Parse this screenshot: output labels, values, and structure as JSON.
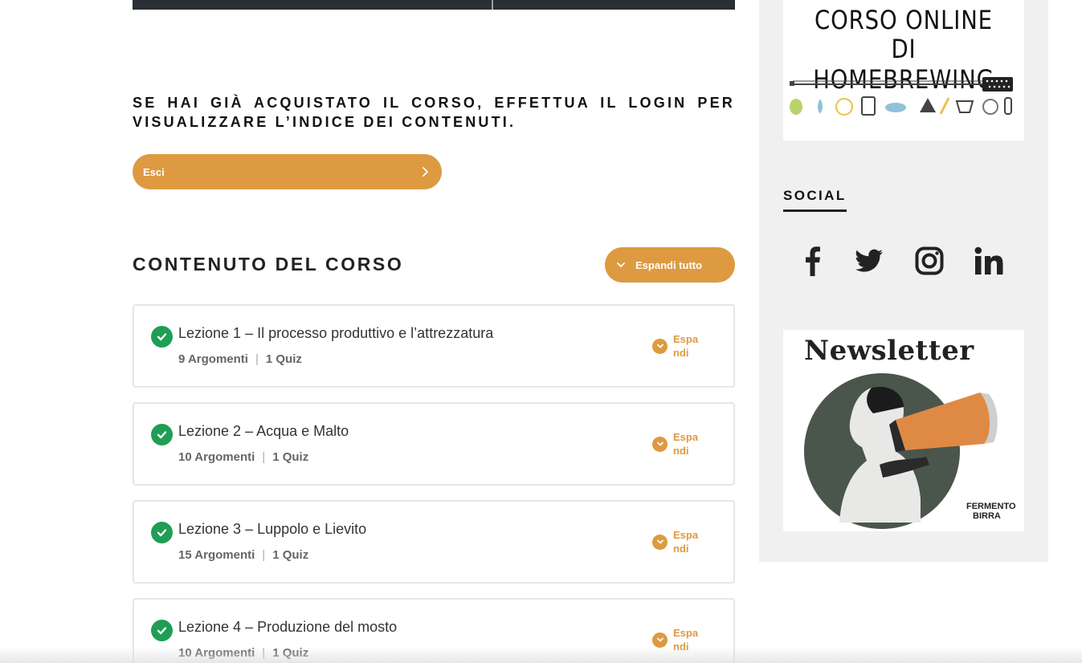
{
  "login_notice": "SE HAI GIÀ ACQUISTATO IL CORSO, EFFETTUA IL LOGIN PER VISUALIZZARE L’INDICE DEI CONTENUTI.",
  "exit_button": "Esci",
  "course_content": {
    "title": "CONTENUTO DEL CORSO",
    "expand_all": "Espandi tutto",
    "expand_label": "Espandi",
    "lessons": [
      {
        "title": "Lezione 1 – Il processo produttivo e l’attrezzatura",
        "topics": "9 Argomenti",
        "quiz": "1 Quiz",
        "completed": true
      },
      {
        "title": "Lezione 2 – Acqua e Malto",
        "topics": "10 Argomenti",
        "quiz": "1 Quiz",
        "completed": true
      },
      {
        "title": "Lezione 3 – Luppolo e Lievito",
        "topics": "15 Argomenti",
        "quiz": "1 Quiz",
        "completed": true
      },
      {
        "title": "Lezione 4 – Produzione del mosto",
        "topics": "10 Argomenti",
        "quiz": "1 Quiz",
        "completed": true
      }
    ]
  },
  "sidebar": {
    "banner": {
      "line1": "CORSO ONLINE",
      "line2": "DI HOMEBREWING"
    },
    "social_heading": "SOCIAL",
    "social_icons": [
      "facebook-icon",
      "twitter-icon",
      "instagram-icon",
      "linkedin-icon"
    ],
    "newsletter": {
      "title": "Newsletter",
      "brand_line1": "FERMENTO",
      "brand_line2": "BIRRA"
    }
  },
  "colors": {
    "accent": "#dd9a40",
    "check": "#1f9e55",
    "sidebar_bg": "#f0f0f0",
    "newsletter_circle": "#4a554c"
  }
}
